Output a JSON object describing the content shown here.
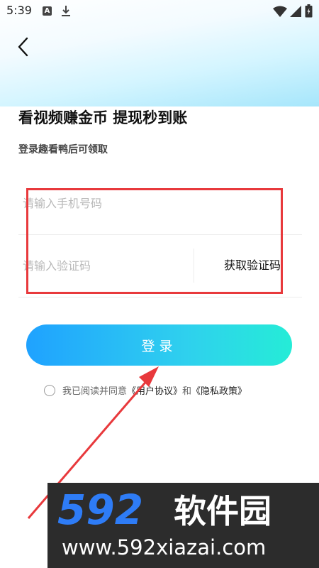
{
  "status_bar": {
    "time": "5:39",
    "notification_icons": [
      "a-icon",
      "download-icon"
    ],
    "system_icons": [
      "wifi-icon",
      "signal-icon",
      "battery-icon"
    ]
  },
  "header": {
    "back_icon": "chevron-left-icon"
  },
  "content": {
    "title": "看视频赚金币 提现秒到账",
    "subtitle": "登录趣看鸭后可领取"
  },
  "form": {
    "phone_placeholder": "请输入手机号码",
    "code_placeholder": "请输入验证码",
    "get_code_label": "获取验证码",
    "login_label": "登录",
    "agreement": {
      "prefix": "我已阅读并同意",
      "user_agreement": "《用户协议》",
      "and": "和",
      "privacy_policy": "《隐私政策》"
    }
  },
  "watermark": {
    "logo": "592软件园",
    "url": "www.592xiazai.com"
  },
  "colors": {
    "accent_start": "#1fa2ff",
    "accent_end": "#25ecd7",
    "annotation": "#e8393c",
    "watermark_bg": "#2c2c2c",
    "watermark_blue": "#2e7cf6"
  }
}
